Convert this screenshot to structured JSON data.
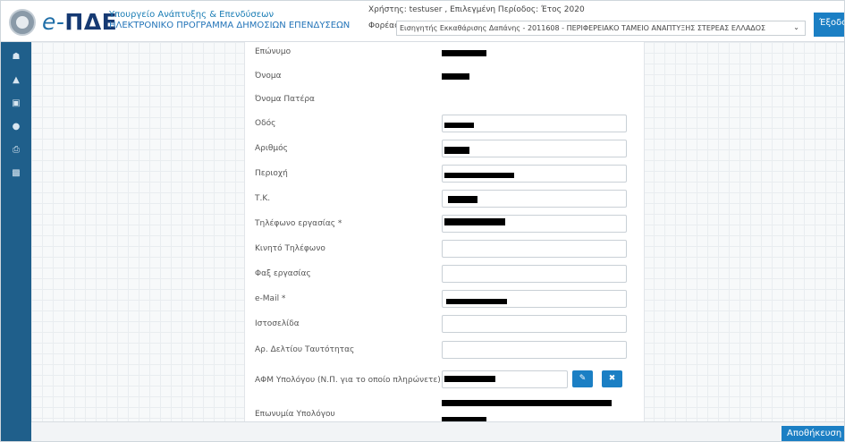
{
  "header": {
    "logo_e": "e-",
    "logo_name": "ΠΔΕ",
    "ministry_line1": "Υπουργείο Ανάπτυξης & Επενδύσεων",
    "ministry_line2": "ΗΛΕΚΤΡΟΝΙΚΟ ΠΡΟΓΡΑΜΜΑ ΔΗΜΟΣΙΩΝ ΕΠΕΝΔΥΣΕΩΝ",
    "user_info": "Χρήστης: testuser , Επιλεγμένη Περίοδος: Έτος 2020",
    "forea_label": "Φορέας:",
    "forea_value": "Εισηγητής Εκκαθάρισης Δαπάνης - 2011608 - ΠΕΡΙΦΕΡΕΙΑΚΟ ΤΑΜΕΙΟ ΑΝΑΠΤΥΞΗΣ ΣΤΕΡΕΑΣ ΕΛΛΑΔΟΣ",
    "logout_label": "Έξοδο"
  },
  "sidebar": {
    "items": [
      {
        "icon": "home-icon"
      },
      {
        "icon": "hierarchy-icon"
      },
      {
        "icon": "money-icon"
      },
      {
        "icon": "user-icon"
      },
      {
        "icon": "print-icon"
      },
      {
        "icon": "book-icon"
      }
    ]
  },
  "form": {
    "labels": {
      "surname": "Επώνυμο",
      "name": "Όνομα",
      "father_name": "Όνομα Πατέρα",
      "street": "Οδός",
      "number": "Αριθμός",
      "area": "Περιοχή",
      "postal_code": "Τ.Κ.",
      "work_phone": "Τηλέφωνο εργασίας *",
      "mobile": "Κινητό Τηλέφωνο",
      "fax": "Φαξ εργασίας",
      "email": "e-Mail *",
      "website": "Ιστοσελίδα",
      "id_card": "Αρ. Δελτίου Ταυτότητας",
      "afm": "ΑΦΜ Υπολόγου (Ν.Π. για το οποίο πληρώνετε) *",
      "company_name": "Επωνυμία Υπολόγου"
    }
  },
  "footer": {
    "save_label": "Αποθήκευση"
  }
}
